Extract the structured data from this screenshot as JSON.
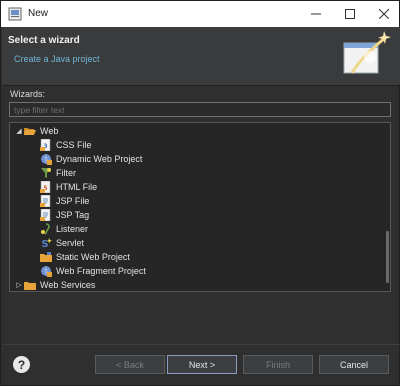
{
  "window": {
    "title": "New",
    "controls": {
      "minimize": "—",
      "maximize": "☐",
      "close": "✕"
    }
  },
  "banner": {
    "title": "Select a wizard",
    "description": "Create a Java project"
  },
  "wizards": {
    "label": "Wizards:",
    "filter_placeholder": "type filter text"
  },
  "tree": {
    "web": {
      "label": "Web",
      "expanded": true
    },
    "children": [
      {
        "label": "CSS File",
        "icon": "css-file-icon"
      },
      {
        "label": "Dynamic Web Project",
        "icon": "web-project-icon"
      },
      {
        "label": "Filter",
        "icon": "filter-icon"
      },
      {
        "label": "HTML File",
        "icon": "html-file-icon"
      },
      {
        "label": "JSP File",
        "icon": "jsp-file-icon"
      },
      {
        "label": "JSP Tag",
        "icon": "jsp-tag-icon"
      },
      {
        "label": "Listener",
        "icon": "listener-icon"
      },
      {
        "label": "Servlet",
        "icon": "servlet-icon"
      },
      {
        "label": "Static Web Project",
        "icon": "folder-icon"
      },
      {
        "label": "Web Fragment Project",
        "icon": "web-project-icon"
      }
    ],
    "web_services": {
      "label": "Web Services",
      "expanded": false
    }
  },
  "buttons": {
    "help": "?",
    "back": "< Back",
    "next": "Next >",
    "finish": "Finish",
    "cancel": "Cancel"
  },
  "colors": {
    "background": "#2f2f2f",
    "banner": "#3a3b3d",
    "link": "#6fb6d8",
    "folder": "#e8a33a"
  }
}
